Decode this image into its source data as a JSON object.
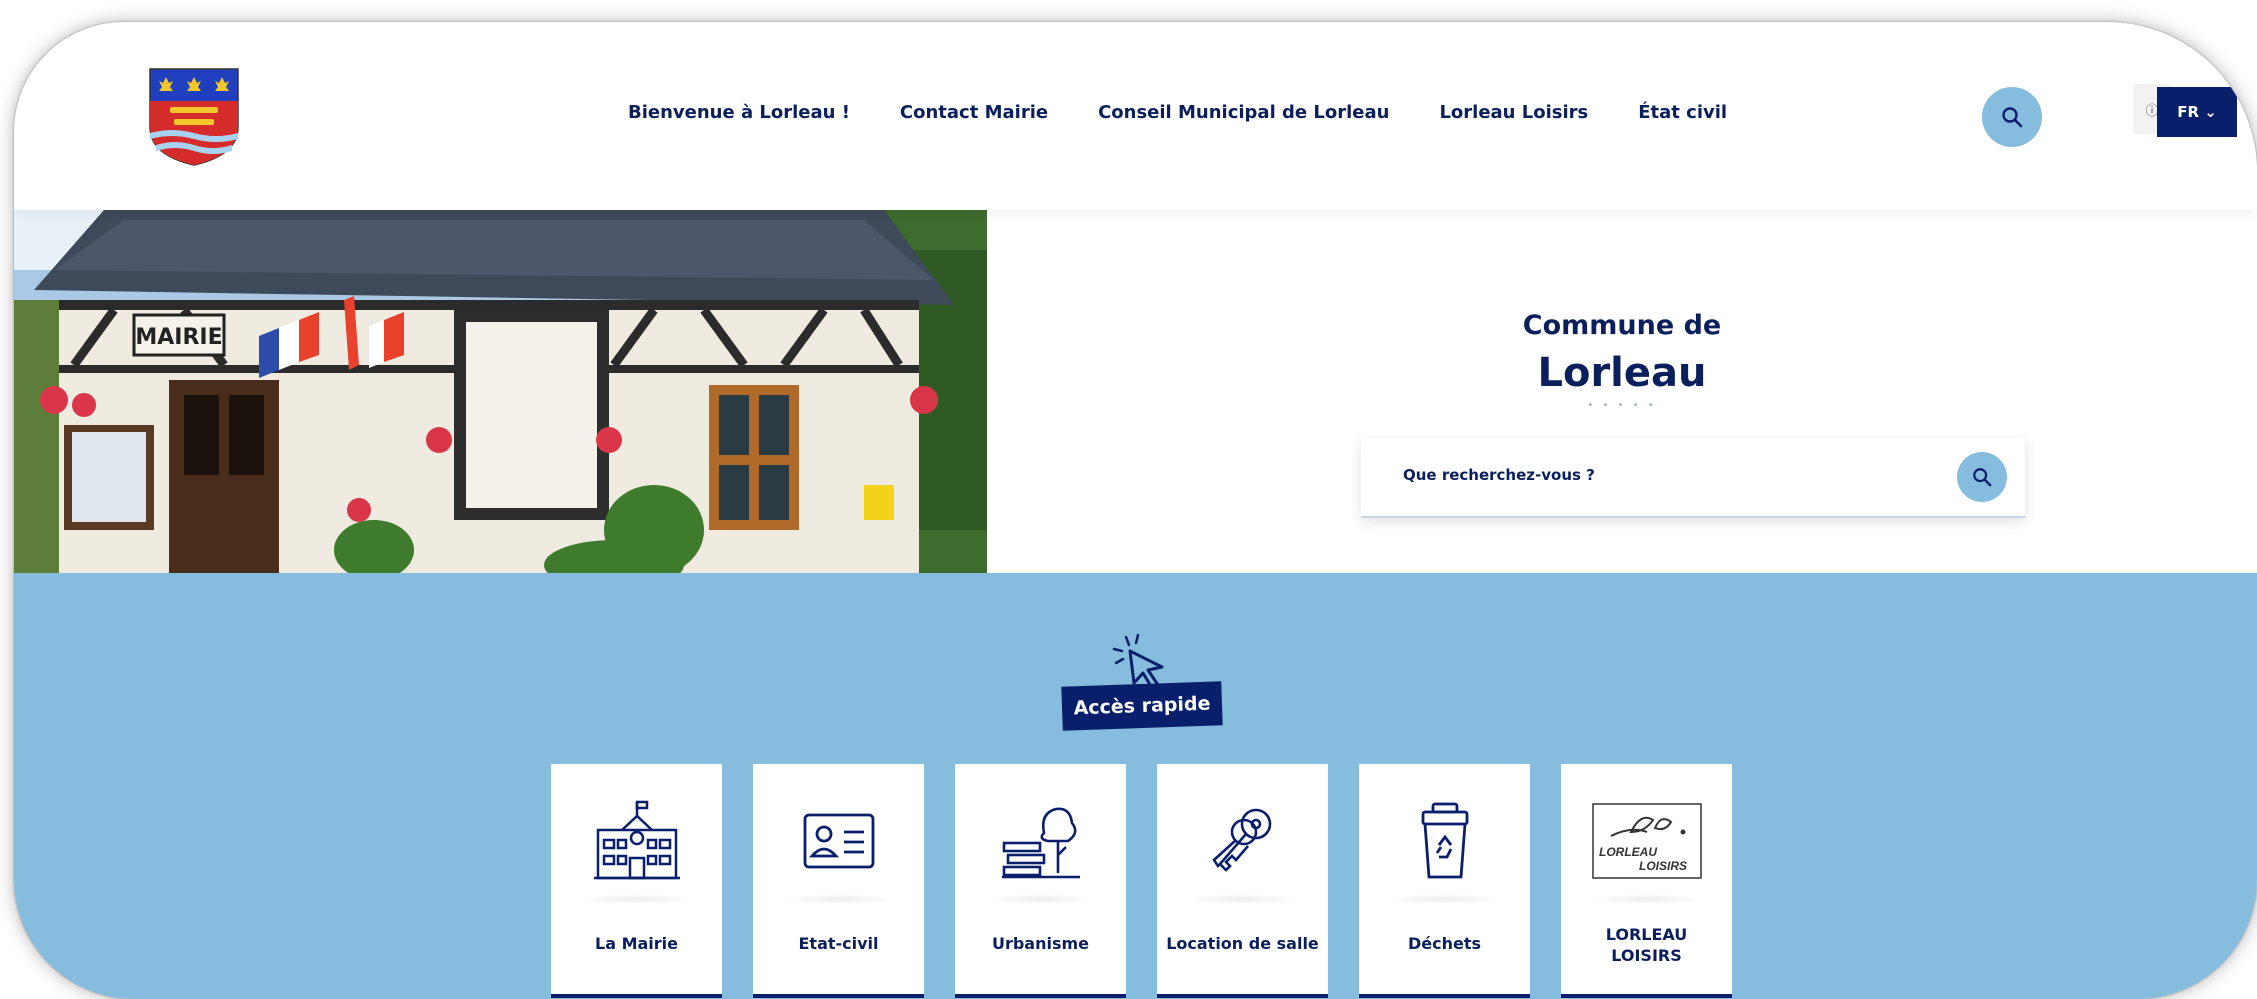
{
  "header": {
    "logo_name": "coat-of-arms",
    "nav": [
      {
        "label": "Bienvenue à Lorleau !"
      },
      {
        "label": "Contact Mairie"
      },
      {
        "label": "Conseil Municipal de Lorleau"
      },
      {
        "label": "Lorleau Loisirs"
      },
      {
        "label": "État civil"
      }
    ],
    "search_icon": "search-icon",
    "lang_info": "ⓘ",
    "lang": "FR ⌄"
  },
  "hero": {
    "photo_sign": "MAIRIE",
    "commune_sub": "Commune de",
    "commune_title": "Lorleau",
    "dots": "• • • • •",
    "search_placeholder": "Que recherchez-vous ?"
  },
  "quick": {
    "badge": "Accès rapide",
    "cards": [
      {
        "label": "La Mairie",
        "icon": "town-hall-icon"
      },
      {
        "label": "Etat-civil",
        "icon": "id-card-icon"
      },
      {
        "label": "Urbanisme",
        "icon": "urban-tree-icon"
      },
      {
        "label": "Location de salle",
        "icon": "keys-icon"
      },
      {
        "label": "Déchets",
        "icon": "recycle-bin-icon"
      },
      {
        "label": "LORLEAU LOISIRS",
        "icon": "lorleau-loisirs-logo",
        "logo_text": "LORLEAU LOISIRS"
      }
    ]
  },
  "colors": {
    "navy": "#0a1f6b",
    "light_blue": "#86bcdd"
  }
}
